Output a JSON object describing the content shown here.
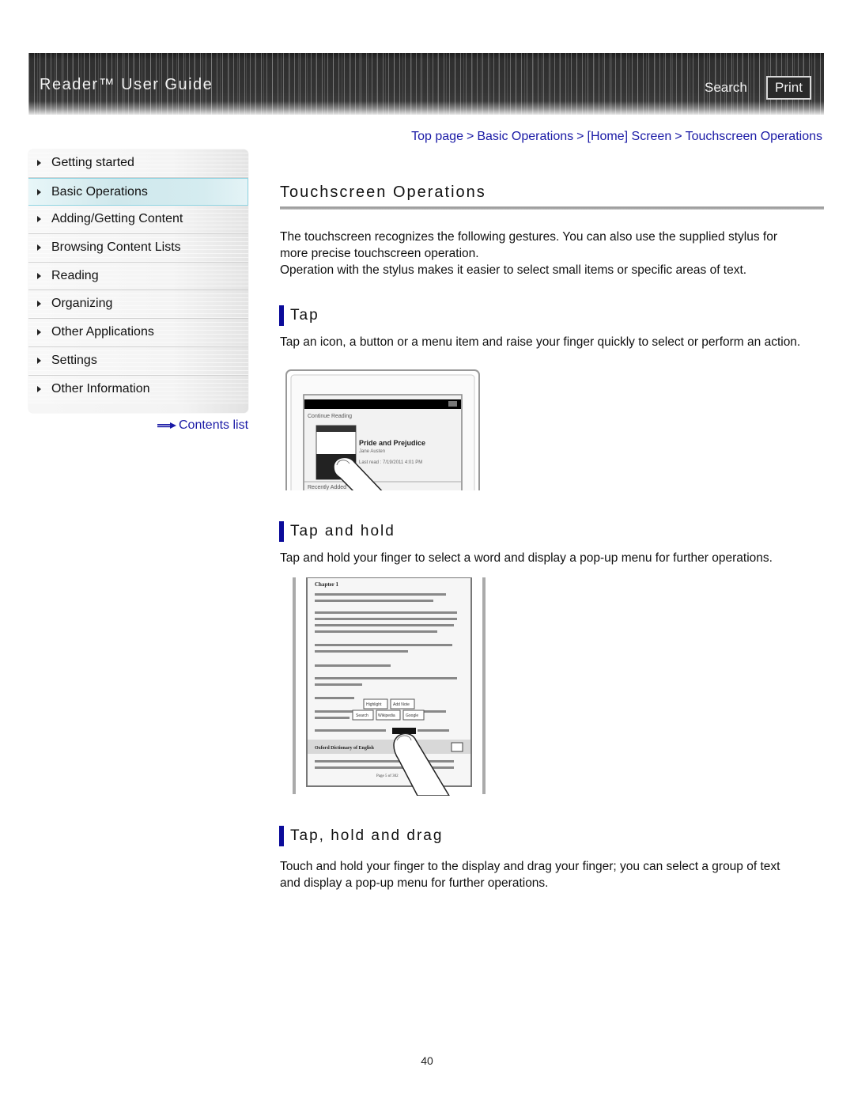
{
  "header": {
    "title": "Reader™ User Guide",
    "search_label": "Search",
    "print_label": "Print"
  },
  "sidebar": {
    "items": [
      {
        "label": "Getting started",
        "active": false
      },
      {
        "label": "Basic Operations",
        "active": true
      },
      {
        "label": "Adding/Getting Content",
        "active": false
      },
      {
        "label": "Browsing Content Lists",
        "active": false
      },
      {
        "label": "Reading",
        "active": false
      },
      {
        "label": "Organizing",
        "active": false
      },
      {
        "label": "Other Applications",
        "active": false
      },
      {
        "label": "Settings",
        "active": false
      },
      {
        "label": "Other Information",
        "active": false
      }
    ],
    "contents_link": "Contents list"
  },
  "breadcrumb": {
    "items": [
      "Top page",
      "Basic Operations",
      "[Home] Screen",
      "Touchscreen Operations"
    ],
    "separator": ">"
  },
  "main": {
    "title": "Touchscreen Operations",
    "intro_line1": "The touchscreen recognizes the following gestures. You can also use the supplied stylus for",
    "intro_line2": "more precise touchscreen operation.",
    "intro_line3": "Operation with the stylus makes it easier to select small items or specific areas of text.",
    "sections": [
      {
        "heading": "Tap",
        "text": "Tap an icon, a button or a menu item and raise your finger quickly to select or perform an action.",
        "illustration": {
          "header_label": "Continue Reading",
          "book_title": "Pride and Prejudice",
          "book_author": "Jane Austen",
          "last_read": "Last read : 7/19/2011 4:01 PM",
          "footer_label": "Recently Added"
        }
      },
      {
        "heading": "Tap and hold",
        "text": "Tap and hold your finger to select a word and display a pop-up menu for further operations.",
        "illustration": {
          "chapter": "Chapter 1",
          "popup_row1": [
            "Highlight",
            "Add Note"
          ],
          "popup_row2": [
            "Search",
            "Wikipedia",
            "Google"
          ],
          "dictionary_label": "Oxford Dictionary of English",
          "page_label": "Page 5 of 302"
        }
      },
      {
        "heading": "Tap, hold and drag",
        "text_line1": "Touch and hold your finger to the display and drag your finger; you can select a group of text",
        "text_line2": "and display a pop-up menu for further operations."
      }
    ]
  },
  "footer": {
    "page_number": "40"
  },
  "colors": {
    "link": "#1a1aa6",
    "section_bar": "#0b0b9a",
    "header_bg": "#333333",
    "active_item": "#cfe8ec"
  }
}
